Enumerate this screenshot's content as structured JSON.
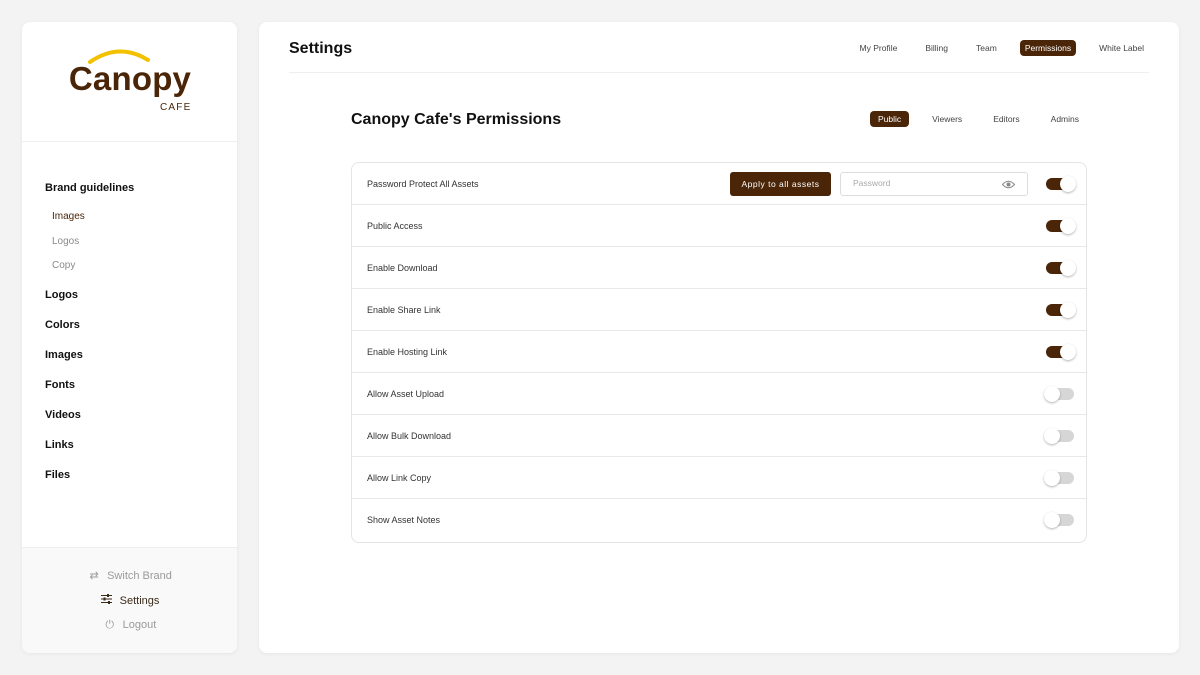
{
  "brand": {
    "name": "Canopy",
    "sub": "CAFE",
    "colors": {
      "accent": "#4a2508",
      "arc": "#f2c200"
    }
  },
  "sidebar": {
    "sections": [
      {
        "label": "Brand guidelines",
        "children": [
          "Images",
          "Logos",
          "Copy"
        ]
      },
      {
        "label": "Logos"
      },
      {
        "label": "Colors"
      },
      {
        "label": "Images"
      },
      {
        "label": "Fonts"
      },
      {
        "label": "Videos"
      },
      {
        "label": "Links"
      },
      {
        "label": "Files"
      }
    ],
    "footer": {
      "switch_brand": "Switch Brand",
      "settings": "Settings",
      "logout": "Logout"
    }
  },
  "header": {
    "title": "Settings",
    "tabs": [
      "My Profile",
      "Billing",
      "Team",
      "Permissions",
      "White Label"
    ],
    "active_tab": "Permissions"
  },
  "permissions": {
    "title": "Canopy Cafe's Permissions",
    "roles": [
      "Public",
      "Viewers",
      "Editors",
      "Admins"
    ],
    "active_role": "Public",
    "apply_label": "Apply to all assets",
    "password_placeholder": "Password",
    "rows": [
      {
        "label": "Password Protect All Assets",
        "enabled": true
      },
      {
        "label": "Public Access",
        "enabled": true
      },
      {
        "label": "Enable Download",
        "enabled": true
      },
      {
        "label": "Enable Share Link",
        "enabled": true
      },
      {
        "label": "Enable Hosting Link",
        "enabled": true
      },
      {
        "label": "Allow Asset Upload",
        "enabled": false
      },
      {
        "label": "Allow Bulk Download",
        "enabled": false
      },
      {
        "label": "Allow Link Copy",
        "enabled": false
      },
      {
        "label": "Show Asset Notes",
        "enabled": false
      }
    ]
  }
}
